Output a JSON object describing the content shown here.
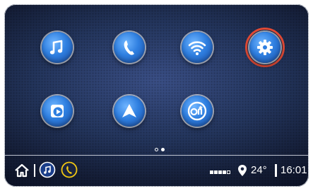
{
  "apps": [
    {
      "id": "music",
      "icon": "music-note-icon"
    },
    {
      "id": "phone",
      "icon": "phone-icon"
    },
    {
      "id": "wifi",
      "icon": "wifi-icon"
    },
    {
      "id": "settings",
      "icon": "gear-icon",
      "selected": true
    },
    {
      "id": "media-player",
      "icon": "play-icon"
    },
    {
      "id": "navigation",
      "icon": "navigation-arrow-icon"
    },
    {
      "id": "onstar",
      "icon": "onstar-icon"
    }
  ],
  "pagination": {
    "pages": 2,
    "current": 2
  },
  "status_bar": {
    "temperature": "24°",
    "time": "16:01",
    "signal_bars_filled": 4,
    "signal_bars_total": 5,
    "icons": [
      "home-icon",
      "music-note-icon",
      "phone-icon",
      "location-pin-icon"
    ]
  },
  "colors": {
    "app_blue": "#2f7fe0",
    "selection_ring": "#e34b36",
    "phone_accent": "#f2c811"
  }
}
